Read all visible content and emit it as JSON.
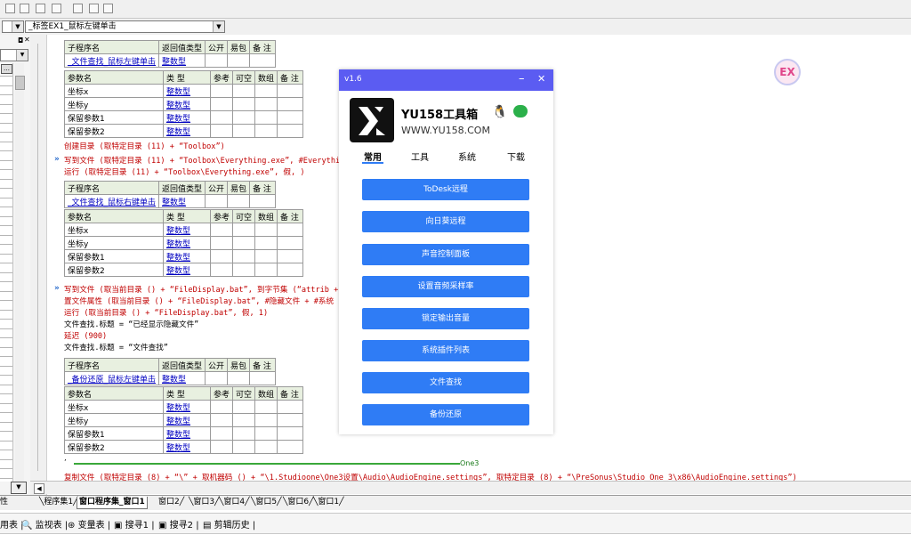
{
  "toolbar": {
    "icons": [
      "align-top-icon",
      "align-middle-icon",
      "align-bottom-icon",
      "equal-width-icon",
      "equal-height-icon",
      "grid-icon"
    ]
  },
  "selector": {
    "left_value": "",
    "event_value": "_标签EX1_鼠标左键单击"
  },
  "code": {
    "table1": {
      "header": [
        "子程序名",
        "返回值类型",
        "公开",
        "易包",
        "备 注"
      ],
      "name": "_文件查找_鼠标左键单击",
      "ret": "整数型",
      "param_header": [
        "参数名",
        "类 型",
        "参考",
        "可空",
        "数组",
        "备 注"
      ],
      "params": [
        [
          "坐标x",
          "整数型"
        ],
        [
          "坐标y",
          "整数型"
        ],
        [
          "保留参数1",
          "整数型"
        ],
        [
          "保留参数2",
          "整数型"
        ]
      ]
    },
    "line1": "创建目录 (取特定目录 (11) + “Toolbox”)",
    "line2": "写到文件 (取特定目录 (11) + “Toolbox\\Everything.exe”, #Everything",
    "line3": "运行 (取特定目录 (11) + “Toolbox\\Everything.exe”, 假, )",
    "table2": {
      "header": [
        "子程序名",
        "返回值类型",
        "公开",
        "易包",
        "备 注"
      ],
      "name": "_文件查找_鼠标右键单击",
      "ret": "整数型",
      "param_header": [
        "参数名",
        "类 型",
        "参考",
        "可空",
        "数组",
        "备 注"
      ],
      "params": [
        [
          "坐标x",
          "整数型"
        ],
        [
          "坐标y",
          "整数型"
        ],
        [
          "保留参数1",
          "整数型"
        ],
        [
          "保留参数2",
          "整数型"
        ]
      ]
    },
    "line4": "写到文件 (取当前目录 () + “FileDisplay.bat”, 到字节集 (“attrib +",
    "line5": "置文件属性 (取当前目录 () + “FileDisplay.bat”, #隐藏文件 + #系统",
    "line6": "运行 (取当前目录 () + “FileDisplay.bat”, 假, 1)",
    "line7": "文件查找.标题 = “已经显示隐藏文件”",
    "line8": "延迟 (900)",
    "line9": "文件查找.标题 = “文件查找”",
    "table3": {
      "header": [
        "子程序名",
        "返回值类型",
        "公开",
        "易包",
        "备 注"
      ],
      "name": "_备份还原_鼠标左键单击",
      "ret": "整数型",
      "param_header": [
        "参数名",
        "类 型",
        "参考",
        "可空",
        "数组",
        "备 注"
      ],
      "params": [
        [
          "坐标x",
          "整数型"
        ],
        [
          "坐标y",
          "整数型"
        ],
        [
          "保留参数1",
          "整数型"
        ],
        [
          "保留参数2",
          "整数型"
        ]
      ]
    },
    "one3": "One3",
    "line10": "复制文件 (取特定目录 (8) + “\\” + 取机器码 () + “\\1.Studioone\\One3设置\\Audio\\AudioEngine.settings”, 取特定目录 (8) + “\\PreSonus\\Studio One 3\\x86\\AudioEngine.settings”)"
  },
  "tabs": [
    "程序集1",
    "窗口程序集_窗口1",
    "窗口2",
    "窗口3",
    "窗口4",
    "窗口5",
    "窗口6",
    "窗口1"
  ],
  "tab_left": "性",
  "bottom_tools": [
    "用表",
    "监视表",
    "变量表",
    "搜寻1",
    "搜寻2",
    "剪辑历史"
  ],
  "dialog": {
    "version": "v1.6",
    "minimize": "–",
    "close": "✕",
    "app_name": "YU158工具箱",
    "url": "WWW.YU158.COM",
    "nav": [
      "常用",
      "工具",
      "系统",
      "下载"
    ],
    "buttons": [
      "ToDesk远程",
      "向日葵远程",
      "声音控制面板",
      "设置音频采样率",
      "锁定输出音量",
      "系统插件列表",
      "文件查找",
      "备份还原"
    ]
  },
  "badge": "EX",
  "colors": {
    "dialog_bar": "#5b5cf2",
    "dialog_button": "#2f7cf5",
    "code_red": "#c00000"
  }
}
